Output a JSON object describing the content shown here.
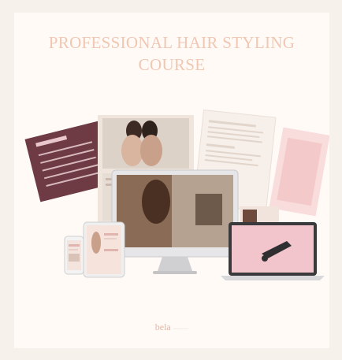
{
  "hero": {
    "title_line1": "PROFESSIONAL HAIR STYLING",
    "title_line2": "COURSE"
  },
  "brand": {
    "name": "bela",
    "tagline": "———"
  },
  "colors": {
    "background": "#f7f1eb",
    "card": "#fffaf6",
    "title": "#f0c7b2",
    "worksheet": "#6e3a44",
    "laptop_screen": "#f2c4cc",
    "device": "#d9d9dc"
  },
  "icons": [
    "worksheet-page",
    "photo-page",
    "text-page",
    "desktop-monitor",
    "laptop",
    "tablet",
    "phone"
  ]
}
